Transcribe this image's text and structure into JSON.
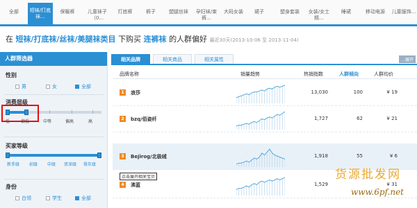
{
  "top_tabs": [
    {
      "label": "全部",
      "active": false
    },
    {
      "label": "短袜/打底袜...",
      "active": true
    },
    {
      "label": "保暖裤",
      "active": false
    },
    {
      "label": "儿童袜子（0...",
      "active": false
    },
    {
      "label": "打底裤",
      "active": false
    },
    {
      "label": "裤子",
      "active": false
    },
    {
      "label": "塑腿丝袜",
      "active": false
    },
    {
      "label": "孕妇袜/束裤...",
      "active": false
    },
    {
      "label": "大码女装",
      "active": false
    },
    {
      "label": "裙子",
      "active": false
    },
    {
      "label": "塑身套装",
      "active": false
    },
    {
      "label": "女装/女士精...",
      "active": false
    },
    {
      "label": "睡裙",
      "active": false
    },
    {
      "label": "移动电源",
      "active": false
    },
    {
      "label": "儿童服饰...",
      "active": false
    }
  ],
  "headline": {
    "prefix": "在",
    "category": "短袜/打底袜/丝袜/美腿袜类目",
    "middle": "下购买",
    "product": "连裤袜",
    "suffix": "的人群偏好",
    "range_prefix": "最近30天(",
    "range_start": "2013-10-06",
    "range_mid": "至",
    "range_end": "2013-11-04",
    "range_suffix": ")"
  },
  "filter": {
    "title": "人群筛选器",
    "gender": {
      "title": "性别",
      "options": [
        "男",
        "女",
        "全部"
      ],
      "selected": 2
    },
    "spending": {
      "title": "消费层级",
      "ticks": [
        "低",
        "偏低",
        "中等",
        "偏高",
        "高"
      ],
      "range": [
        0,
        1
      ]
    },
    "buyer_level": {
      "title": "买家等级",
      "ticks": [
        "新手级",
        "初级",
        "中级",
        "资深级",
        "骨灰级"
      ],
      "range": [
        0,
        4
      ]
    },
    "identity": {
      "title": "身份",
      "options": [
        "白领",
        "学生",
        "全部"
      ],
      "selected": 2
    }
  },
  "subtabs": [
    {
      "label": "相关品牌",
      "active": true
    },
    {
      "label": "相关商品",
      "active": false
    },
    {
      "label": "相关属性",
      "active": false
    }
  ],
  "more_label": "...展开",
  "columns": {
    "name": "品牌名称",
    "trend": "销量趋势",
    "hot": "热销指数",
    "pop": "人群倾向",
    "price": "人群均价"
  },
  "rows": [
    {
      "rank": "1",
      "brand": "浪莎",
      "hot": "13,030",
      "pop": "100",
      "price": "¥ 19",
      "spark": [
        6,
        7,
        8,
        9,
        10,
        9,
        11,
        12,
        12,
        13,
        14,
        13,
        15,
        16,
        15,
        17,
        18,
        17,
        18,
        19
      ]
    },
    {
      "rank": "2",
      "brand": "bzq/佰姿纤",
      "hot": "1,727",
      "pop": "62",
      "price": "¥ 21",
      "spark": [
        4,
        5,
        5,
        6,
        7,
        6,
        8,
        9,
        8,
        10,
        12,
        11,
        13,
        14,
        13,
        15,
        17,
        16,
        18,
        20
      ]
    },
    {
      "rank": "3",
      "brand": "Bejirog/北极绒",
      "hot": "1,918",
      "pop": "55",
      "price": "¥ 6",
      "spark": [
        3,
        4,
        4,
        5,
        6,
        5,
        7,
        9,
        8,
        10,
        14,
        12,
        15,
        18,
        14,
        12,
        11,
        10,
        9,
        8
      ]
    },
    {
      "rank": "4",
      "brand": "沸蓝",
      "hot": "1,529",
      "pop": "",
      "price": "¥ 31",
      "spark": [
        5,
        6,
        6,
        7,
        8,
        7,
        9,
        10,
        9,
        11,
        12,
        11,
        12,
        13,
        12,
        13,
        14,
        13,
        14,
        15
      ]
    }
  ],
  "tooltip": "点击展开相关宝贝",
  "watermark": {
    "main": "货源批发网",
    "site": "www.6pf.net"
  },
  "colors": {
    "accent": "#2b8fd4",
    "rank_badge": "#f08a24",
    "highlight_box": "#e01010"
  }
}
